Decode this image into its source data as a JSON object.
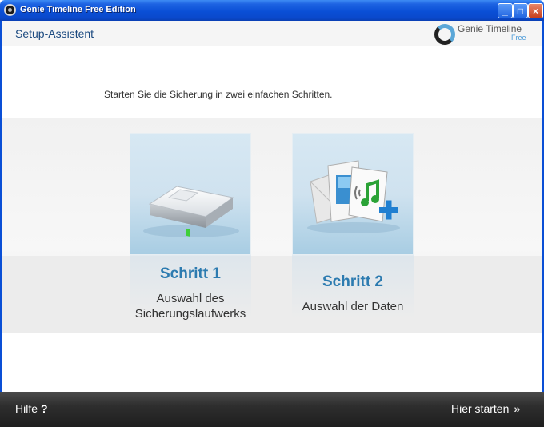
{
  "window": {
    "title": "Genie Timeline Free Edition",
    "buttons": {
      "minimize": "_",
      "maximize": "□",
      "close": "×"
    }
  },
  "header": {
    "title": "Setup-Assistent",
    "logo_name": "Genie Timeline",
    "logo_edition": "Free"
  },
  "intro": "Starten Sie die Sicherung in zwei einfachen Schritten.",
  "steps": [
    {
      "title": "Schritt 1",
      "line1": "Auswahl des",
      "line2": "Sicherungslaufwerks",
      "icon": "hard-drive-icon"
    },
    {
      "title": "Schritt 2",
      "line1": "Auswahl der Daten",
      "line2": "",
      "icon": "data-files-icon"
    }
  ],
  "footer": {
    "help_label": "Hilfe",
    "help_mark": "?",
    "start_label": "Hier starten",
    "start_arrow": "»"
  },
  "colors": {
    "title_bar": "#0a4fd6",
    "accent": "#2c7bb0",
    "footer": "#2e2e2e"
  }
}
